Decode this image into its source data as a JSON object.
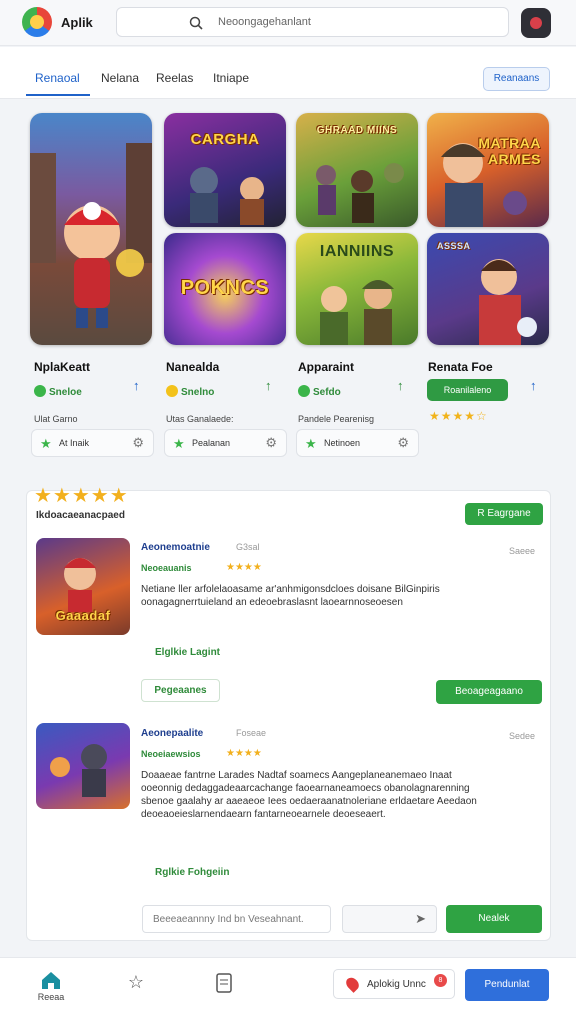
{
  "header": {
    "app_name": "Aplik",
    "search_placeholder": "Neoongagehanlant"
  },
  "tabs": [
    {
      "label": "Renaoal"
    },
    {
      "label": "Nelana"
    },
    {
      "label": "Reelas"
    },
    {
      "label": "Itniape"
    }
  ],
  "tab_action": "Reanaans",
  "tiles": [
    {
      "text": ""
    },
    {
      "text": "CARGHA"
    },
    {
      "text": "GHRAAD MIINS"
    },
    {
      "text": "MATRAA ARMES"
    },
    {
      "text": "POKNCS"
    },
    {
      "text": "IANNIINS"
    },
    {
      "text": "ASSSA"
    }
  ],
  "games": [
    {
      "title": "NplaKeatt",
      "meta": "Sneloe",
      "label": "Ulat Garno",
      "chip": "At Inaik"
    },
    {
      "title": "Nanealda",
      "meta": "Snelno",
      "label": "Utas Ganalaede:",
      "chip": "Pealanan"
    },
    {
      "title": "Apparaint",
      "meta": "Sefdo",
      "label": "Pandele Pearenisg",
      "chip": "Netinoen"
    },
    {
      "title": "Renata Foe",
      "meta": "Roanilaleno",
      "stars": "★★★★☆"
    }
  ],
  "review_card": {
    "stars": "★★★★★",
    "subtitle": "Ikdoacaeanacpaed",
    "top_button": "R Eagrgane",
    "reviews": [
      {
        "thumb_text": "Gaaadaf",
        "name": "Aeonemoatnie",
        "id": "G3sal",
        "author": "Neoeauanis",
        "stars": "★★★★",
        "date": "Saeee",
        "body": "Netiane ller arfolelaoasame ar'anhmigonsdcloes doisane BilGinpiris oonagagnerrtuieland an edeoebraslasnt laoearnnoseoesen",
        "tag": "Elglkie Lagint",
        "outline_button": "Pegeaanes",
        "green_button": "Beoageagaano"
      },
      {
        "name": "Aeonepaalite",
        "id": "Foseae",
        "author": "Neoeiaewsios",
        "stars": "★★★★",
        "date": "Sedee",
        "body": "Doaaeae fantrne Larades Nadtaf soamecs Aangeplaneanemaeo Inaat ooeonnig dedaggadeaarcachange faoearnaneamoecs obanolagnarenning sbenoe gaalahy ar aaeaeoe Iees oedaeraanatnoleriane erldaetare Aeedaon deoeaoeieslarnendaearn fantarneoearnele deoeseaert.",
        "tag": "Rglkie Fohgeiin"
      }
    ],
    "comment_placeholder": "Beeeaeannny Ind bn Veseahnant.",
    "submit_button": "Nealek"
  },
  "bottom_nav": {
    "home_label": "Reeaa",
    "apply_label": "Aplokig Unnc",
    "apply_count": "8",
    "primary_button": "Pendunlat"
  }
}
